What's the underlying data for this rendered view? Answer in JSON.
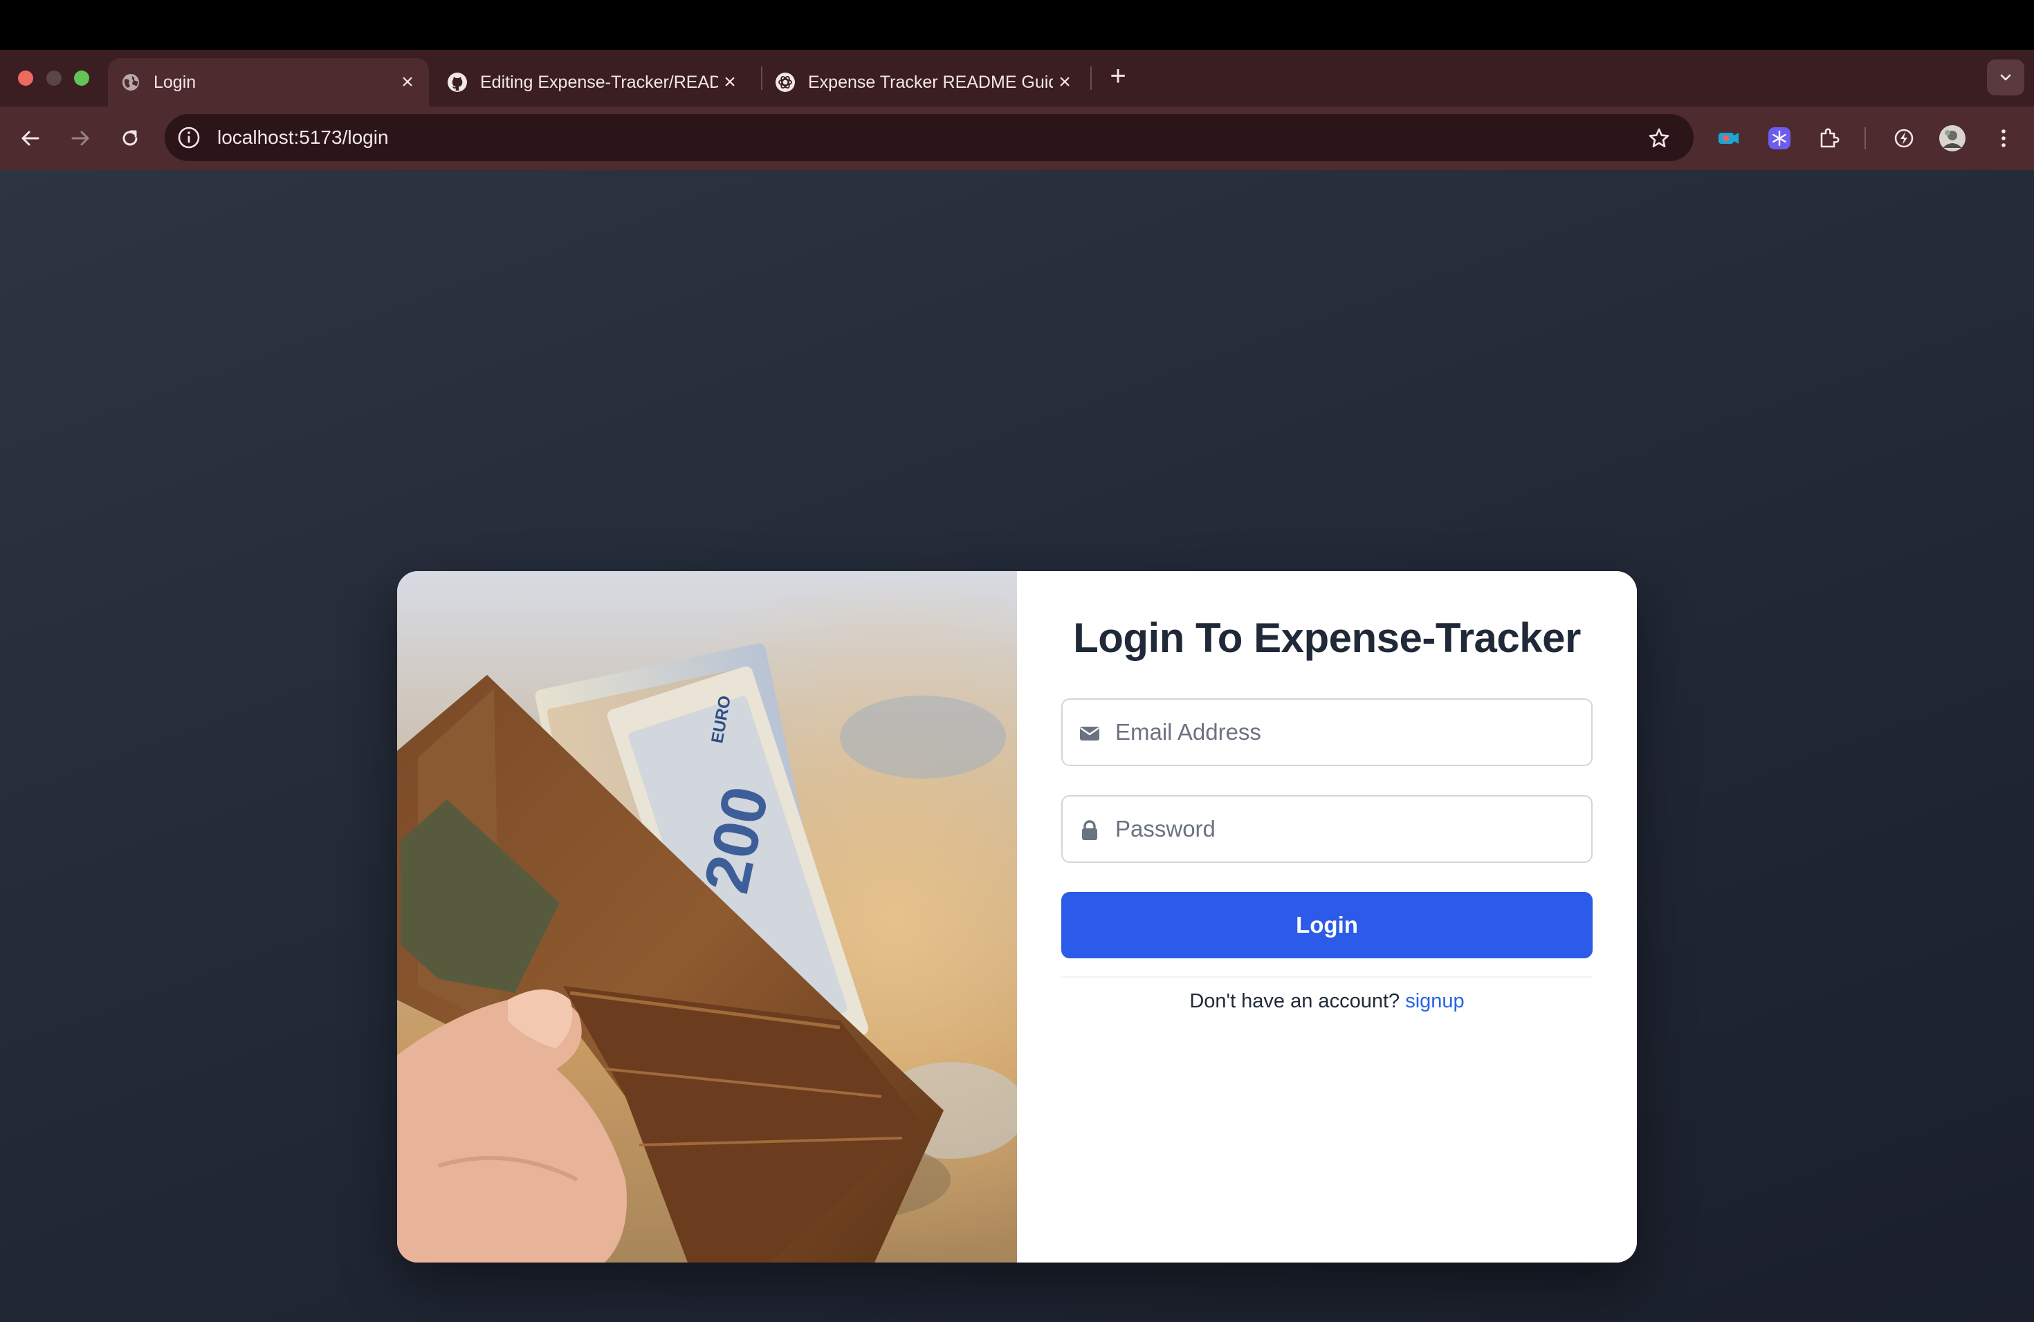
{
  "browser": {
    "tabs": [
      {
        "title": "Login",
        "favicon": "globe-icon",
        "active": true
      },
      {
        "title": "Editing Expense-Tracker/README.md",
        "favicon": "github-icon",
        "active": false
      },
      {
        "title": "Expense Tracker README Guide",
        "favicon": "openai-icon",
        "active": false
      }
    ],
    "url": "localhost:5173/login",
    "new_tab_symbol": "+",
    "close_symbol": "×"
  },
  "login": {
    "title": "Login To Expense-Tracker",
    "email_placeholder": "Email Address",
    "password_placeholder": "Password",
    "button_label": "Login",
    "signup_prompt": "Don't have an account?",
    "signup_link": "signup"
  },
  "illustration": {
    "banknote_text": "EURO",
    "banknote_value": "200"
  },
  "colors": {
    "primary_button": "#2b5be8",
    "link": "#2563eb",
    "title": "#1f2937",
    "chrome_frame": "#3b1e22",
    "chrome_toolbar": "#4d2b2f"
  }
}
